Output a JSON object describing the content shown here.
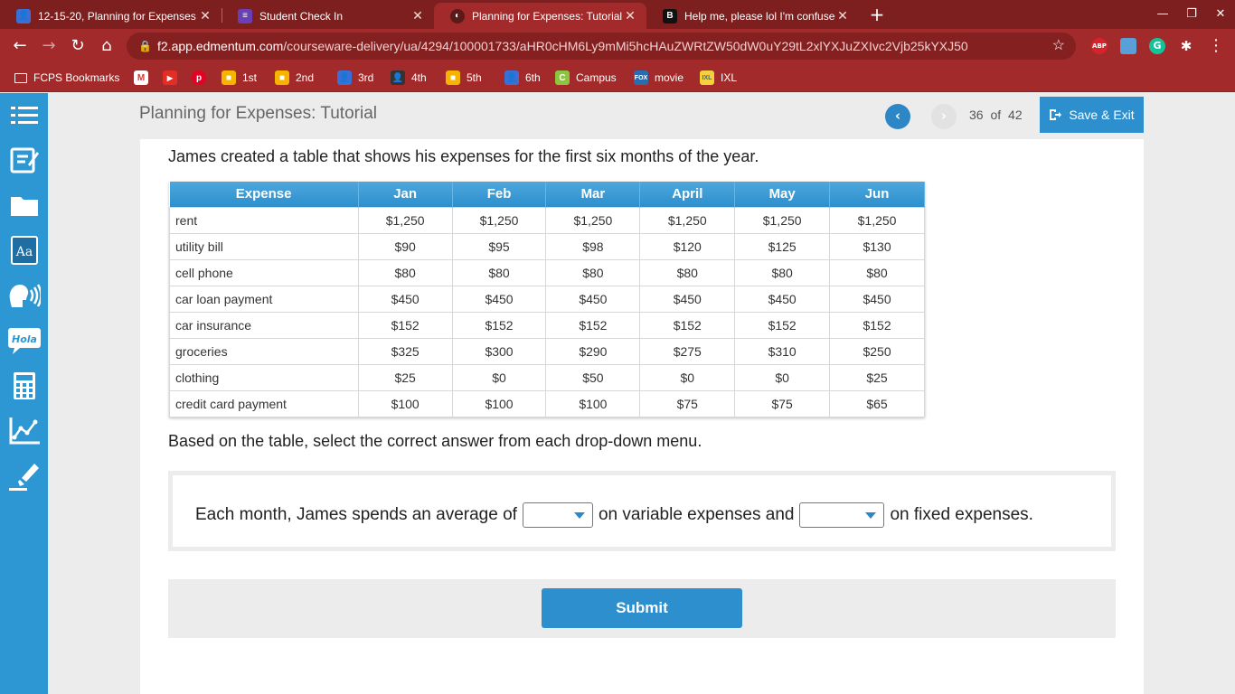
{
  "browser": {
    "tabs": [
      {
        "title": "12-15-20, Planning for Expenses",
        "favicon": "edmentum-person-icon",
        "active": false
      },
      {
        "title": "Student Check In",
        "favicon": "forms-list-icon",
        "active": false
      },
      {
        "title": "Planning for Expenses: Tutorial",
        "favicon": "edmentum-swirl-icon",
        "active": true
      },
      {
        "title": "Help me, please lol I'm confused",
        "favicon": "brainly-icon",
        "active": false
      }
    ],
    "address": {
      "host": "f2.app.edmentum.com",
      "path": "/courseware-delivery/ua/4294/100001733/aHR0cHM6Ly9mMi5hcHAuZWRtZW50dW0uY29tL2xlYXJuZXIvc2Vjb25kYXJ50"
    },
    "extensions": [
      {
        "name": "adblock-icon",
        "label": "ABP",
        "color": "#d8232a"
      },
      {
        "name": "extension-tile-icon",
        "label": "",
        "color": "#5aa0d8"
      },
      {
        "name": "grammarly-icon",
        "label": "G",
        "color": "#15c39a"
      },
      {
        "name": "puzzle-icon",
        "label": "",
        "color": "#ffffff"
      }
    ],
    "bookmarks": [
      {
        "label": "FCPS Bookmarks",
        "icon": "folder-icon"
      },
      {
        "label": "",
        "icon": "gmail-icon"
      },
      {
        "label": "",
        "icon": "youtube-icon"
      },
      {
        "label": "",
        "icon": "pinterest-icon"
      },
      {
        "label": "1st",
        "icon": "classroom-icon"
      },
      {
        "label": "2nd",
        "icon": "classroom-icon"
      },
      {
        "label": "3rd",
        "icon": "person-icon"
      },
      {
        "label": "4th",
        "icon": "person-icon"
      },
      {
        "label": "5th",
        "icon": "classroom-icon"
      },
      {
        "label": "6th",
        "icon": "person-icon"
      },
      {
        "label": "Campus",
        "icon": "campus-icon"
      },
      {
        "label": "movie",
        "icon": "fox-icon"
      },
      {
        "label": "IXL",
        "icon": "ixl-icon"
      }
    ]
  },
  "header": {
    "title": "Planning for Expenses: Tutorial",
    "page_current": "36",
    "page_of": "of",
    "page_total": "42",
    "save_exit_label": "Save & Exit"
  },
  "sidebar": {
    "tools": [
      "menu-icon",
      "notes-icon",
      "folder-icon",
      "dictionary-icon",
      "text-to-speech-icon",
      "translate-icon",
      "calculator-icon",
      "graph-icon",
      "highlighter-icon"
    ],
    "translate_label": "Hola",
    "dictionary_label": "Aa"
  },
  "question": {
    "prompt": "James created a table that shows his expenses for the first six months of the year.",
    "table": {
      "headers": [
        "Expense",
        "Jan",
        "Feb",
        "Mar",
        "April",
        "May",
        "Jun"
      ],
      "rows": [
        [
          "rent",
          "$1,250",
          "$1,250",
          "$1,250",
          "$1,250",
          "$1,250",
          "$1,250"
        ],
        [
          "utility bill",
          "$90",
          "$95",
          "$98",
          "$120",
          "$125",
          "$130"
        ],
        [
          "cell phone",
          "$80",
          "$80",
          "$80",
          "$80",
          "$80",
          "$80"
        ],
        [
          "car loan payment",
          "$450",
          "$450",
          "$450",
          "$450",
          "$450",
          "$450"
        ],
        [
          "car insurance",
          "$152",
          "$152",
          "$152",
          "$152",
          "$152",
          "$152"
        ],
        [
          "groceries",
          "$325",
          "$300",
          "$290",
          "$275",
          "$310",
          "$250"
        ],
        [
          "clothing",
          "$25",
          "$0",
          "$50",
          "$0",
          "$0",
          "$25"
        ],
        [
          "credit card payment",
          "$100",
          "$100",
          "$100",
          "$75",
          "$75",
          "$65"
        ]
      ]
    },
    "instruction": "Based on the table, select the correct answer from each drop-down menu.",
    "answer": {
      "part1": "Each month, James spends an average of",
      "part2": "on variable expenses and",
      "part3": "on fixed expenses.",
      "dropdown1_value": "",
      "dropdown2_value": ""
    },
    "submit_label": "Submit"
  },
  "colors": {
    "chrome": "#a32a2a",
    "accent": "#2d86c5",
    "sidebar": "#2d97d4"
  }
}
